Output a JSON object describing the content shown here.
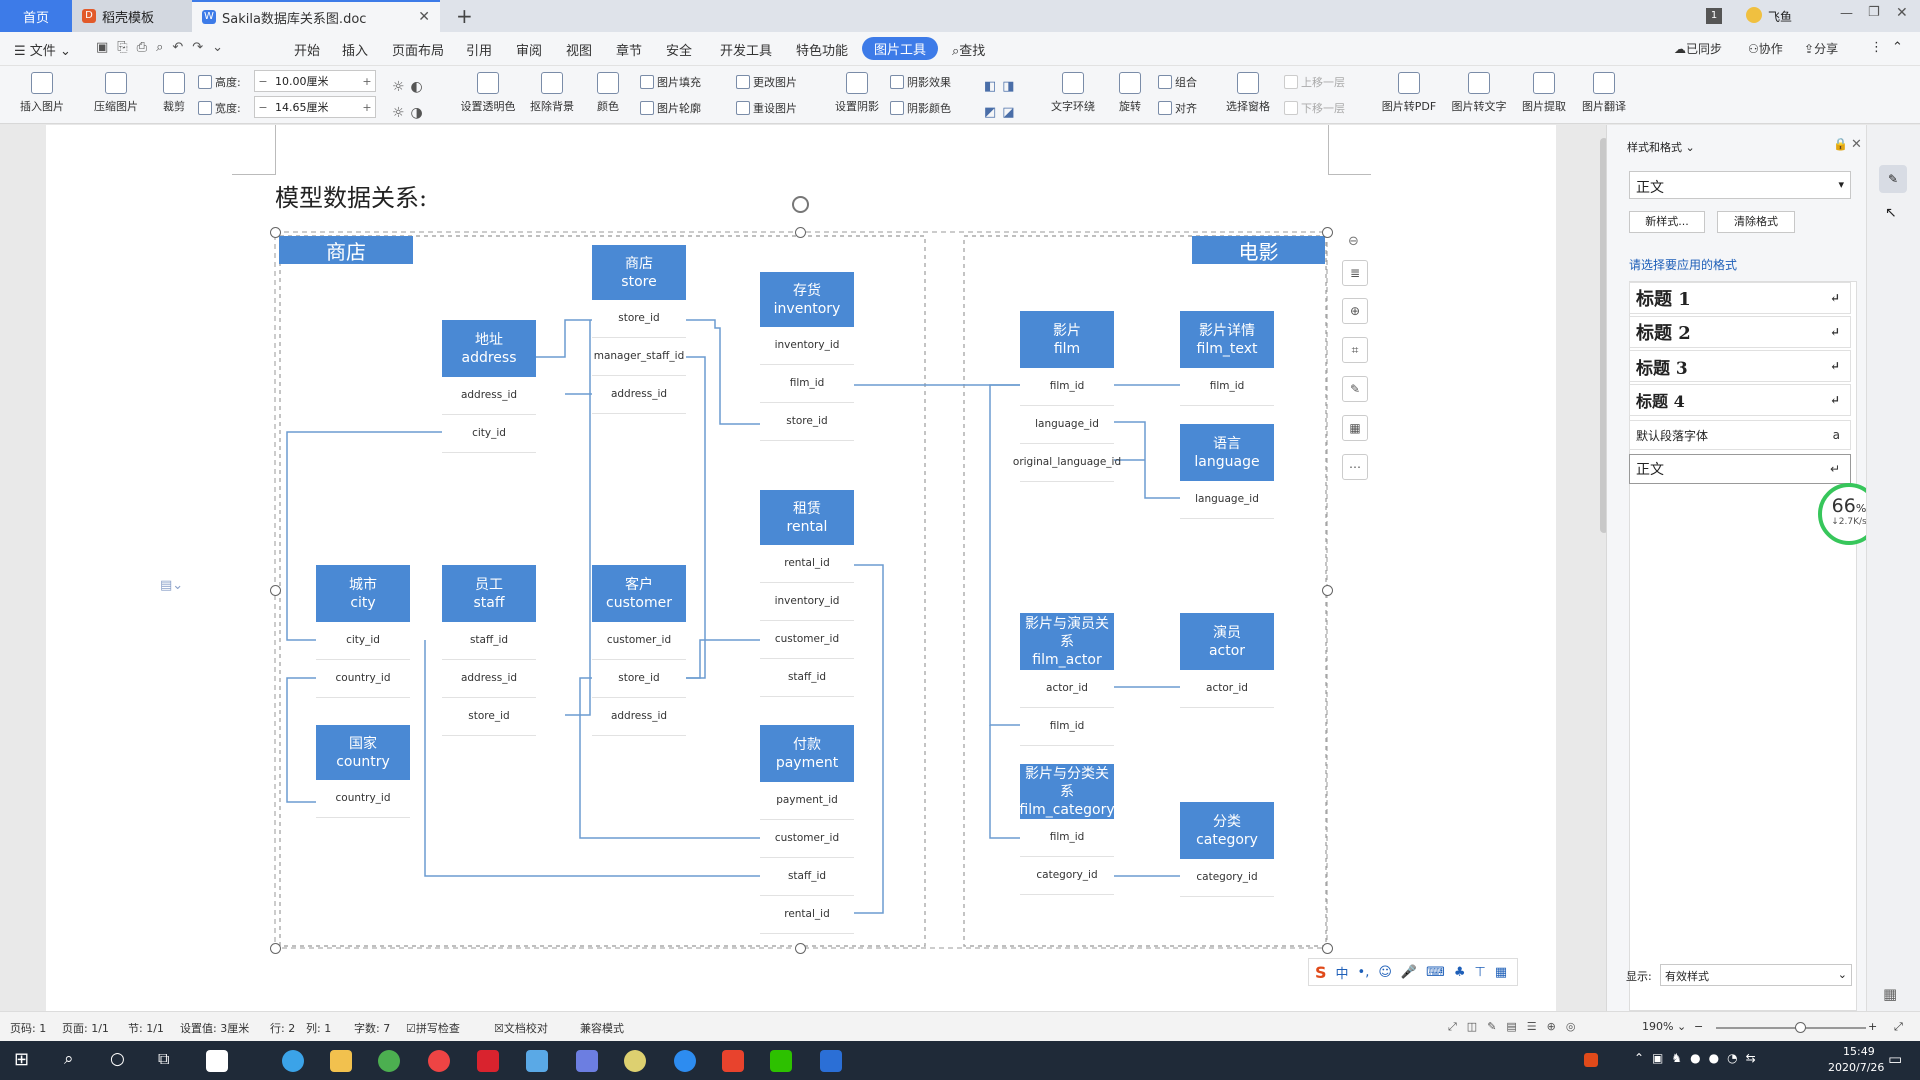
{
  "tabs": {
    "home": "首页",
    "template": "稻壳模板",
    "doc": "Sakila数据库关系图.doc",
    "new": "+"
  },
  "window": {
    "badge": "1",
    "user": "飞鱼"
  },
  "menu": {
    "file": "文件",
    "items": [
      "开始",
      "插入",
      "页面布局",
      "引用",
      "审阅",
      "视图",
      "章节",
      "安全",
      "开发工具",
      "特色功能"
    ],
    "active": "图片工具",
    "search": "查找",
    "sync": "已同步",
    "collab": "协作",
    "share": "分享"
  },
  "ribbon": {
    "insert_pic": "插入图片",
    "compress": "压缩图片",
    "crop": "裁剪",
    "height_label": "高度:",
    "height_value": "10.00厘米",
    "width_label": "宽度:",
    "width_value": "14.65厘米",
    "transparent": "设置透明色",
    "remove_bg": "抠除背景",
    "color": "颜色",
    "fill": "图片填充",
    "outline": "图片轮廓",
    "change": "更改图片",
    "reset": "重设图片",
    "shadow": "设置阴影",
    "shadow_effect": "阴影效果",
    "shadow_color": "阴影颜色",
    "wrap": "文字环绕",
    "rotate": "旋转",
    "group": "组合",
    "align": "对齐",
    "select_pane": "选择窗格",
    "up": "上移一层",
    "down": "下移一层",
    "to_pdf": "图片转PDF",
    "to_text": "图片转文字",
    "extract": "图片提取",
    "translate": "图片翻译"
  },
  "document": {
    "title": "模型数据关系:"
  },
  "diagram": {
    "sections": {
      "store": "商店",
      "film": "电影"
    },
    "tables": [
      {
        "id": "store",
        "cn": "商店",
        "en": "store",
        "fields": [
          "store_id",
          "manager_staff_id",
          "address_id"
        ]
      },
      {
        "id": "address",
        "cn": "地址",
        "en": "address",
        "fields": [
          "address_id",
          "city_id"
        ]
      },
      {
        "id": "inventory",
        "cn": "存货",
        "en": "inventory",
        "fields": [
          "inventory_id",
          "film_id",
          "store_id"
        ]
      },
      {
        "id": "rental",
        "cn": "租赁",
        "en": "rental",
        "fields": [
          "rental_id",
          "inventory_id",
          "customer_id",
          "staff_id"
        ]
      },
      {
        "id": "city",
        "cn": "城市",
        "en": "city",
        "fields": [
          "city_id",
          "country_id"
        ]
      },
      {
        "id": "staff",
        "cn": "员工",
        "en": "staff",
        "fields": [
          "staff_id",
          "address_id",
          "store_id"
        ]
      },
      {
        "id": "customer",
        "cn": "客户",
        "en": "customer",
        "fields": [
          "customer_id",
          "store_id",
          "address_id"
        ]
      },
      {
        "id": "country",
        "cn": "国家",
        "en": "country",
        "fields": [
          "country_id"
        ]
      },
      {
        "id": "payment",
        "cn": "付款",
        "en": "payment",
        "fields": [
          "payment_id",
          "customer_id",
          "staff_id",
          "rental_id"
        ]
      },
      {
        "id": "film",
        "cn": "影片",
        "en": "film",
        "fields": [
          "film_id",
          "language_id",
          "original_language_id"
        ]
      },
      {
        "id": "film_text",
        "cn": "影片详情",
        "en": "film_text",
        "fields": [
          "film_id"
        ]
      },
      {
        "id": "language",
        "cn": "语言",
        "en": "language",
        "fields": [
          "language_id"
        ]
      },
      {
        "id": "film_actor",
        "cn": "影片与演员关系",
        "en": "film_actor",
        "fields": [
          "actor_id",
          "film_id"
        ]
      },
      {
        "id": "actor",
        "cn": "演员",
        "en": "actor",
        "fields": [
          "actor_id"
        ]
      },
      {
        "id": "film_category",
        "cn": "影片与分类关系",
        "en": "film_category",
        "fields": [
          "film_id",
          "category_id"
        ]
      },
      {
        "id": "category",
        "cn": "分类",
        "en": "category",
        "fields": [
          "category_id"
        ]
      }
    ]
  },
  "pane": {
    "title": "样式和格式",
    "current": "正文",
    "new_style": "新样式...",
    "clear": "清除格式",
    "choose": "请选择要应用的格式",
    "styles": [
      "标题 1",
      "标题 2",
      "标题 3",
      "标题 4"
    ],
    "default_font": "默认段落字体",
    "body": "正文",
    "show_label": "显示:",
    "show_value": "有效样式"
  },
  "net": {
    "pct": "66",
    "unit": "%",
    "speed": "2.7K/s"
  },
  "ime": {
    "lang": "中"
  },
  "status": {
    "page": "页码: 1",
    "pages": "页面: 1/1",
    "section": "节: 1/1",
    "setting": "设置值: 3厘米",
    "row": "行: 2",
    "col": "列: 1",
    "words": "字数: 7",
    "spell": "拼写检查",
    "proof": "文档校对",
    "compat": "兼容模式",
    "zoom": "190%"
  },
  "clock": {
    "time": "15:49",
    "date": "2020/7/26"
  },
  "colors": {
    "accent": "#3d7be8",
    "header": "#4a89d4",
    "line": "#6b9bd0"
  }
}
